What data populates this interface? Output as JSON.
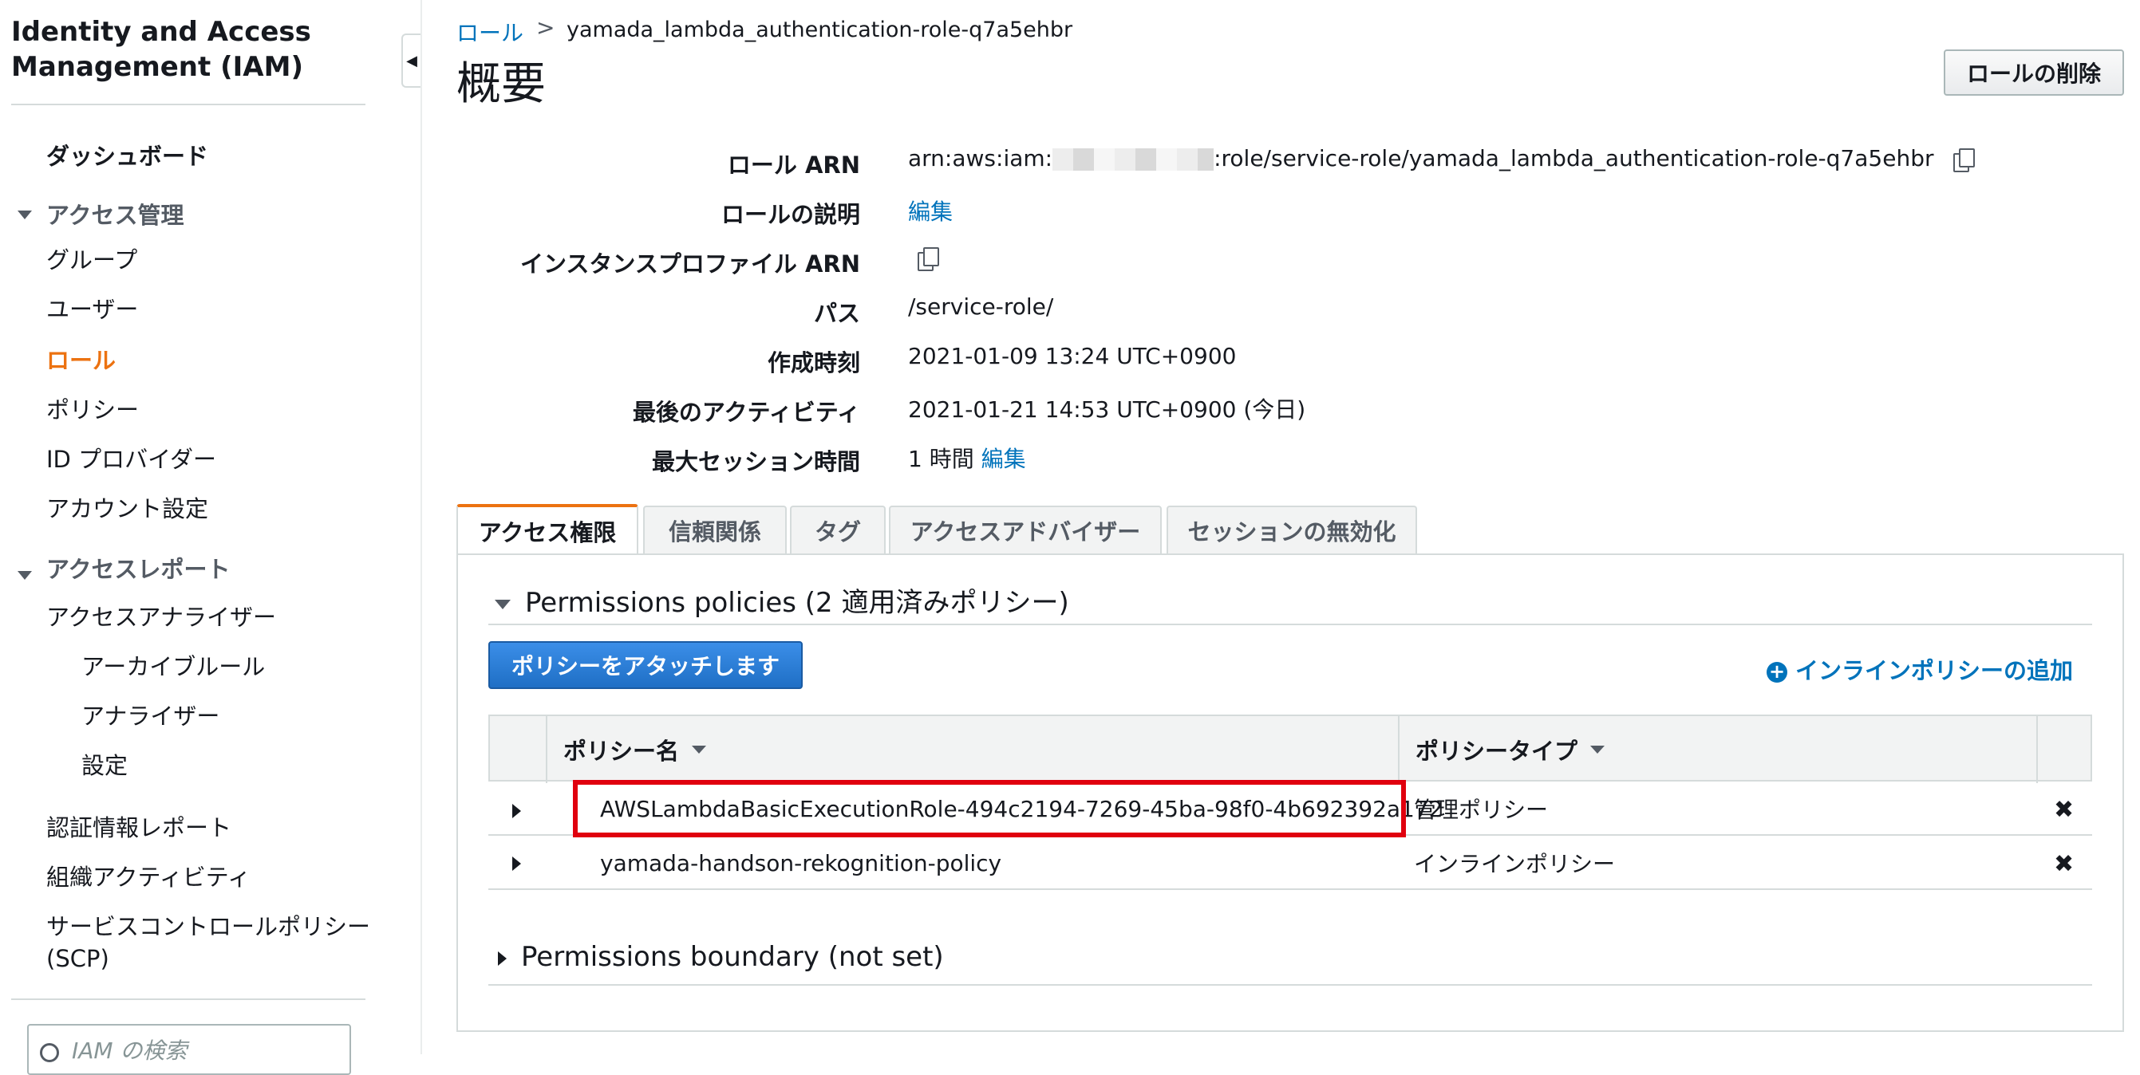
{
  "sidebar": {
    "title": "Identity and Access Management (IAM)",
    "dashboard": "ダッシュボード",
    "access_mgmt": {
      "label": "アクセス管理",
      "items": [
        "グループ",
        "ユーザー",
        "ロール",
        "ポリシー",
        "ID プロバイダー",
        "アカウント設定"
      ],
      "active_index": 2
    },
    "access_reports": {
      "label": "アクセスレポート",
      "analyzer": "アクセスアナライザー",
      "analyzer_children": [
        "アーカイブルール",
        "アナライザー",
        "設定"
      ],
      "credential_report": "認証情報レポート",
      "org_activity": "組織アクティビティ",
      "scp_line1": "サービスコントロールポリシー",
      "scp_line2": "(SCP)"
    },
    "search_placeholder": "IAM の検索"
  },
  "breadcrumb": {
    "parent": "ロール",
    "separator": ">",
    "current": "yamada_lambda_authentication-role-q7a5ehbr"
  },
  "page": {
    "title": "概要",
    "delete_button": "ロールの削除"
  },
  "summary": {
    "role_arn_label": "ロール ARN",
    "role_arn_prefix": "arn:aws:iam:",
    "role_arn_suffix": ":role/service-role/yamada_lambda_authentication-role-q7a5ehbr",
    "description_label": "ロールの説明",
    "description_edit": "編集",
    "instance_profile_label": "インスタンスプロファイル ARN",
    "path_label": "パス",
    "path_value": "/service-role/",
    "created_label": "作成時刻",
    "created_value": "2021-01-09 13:24 UTC+0900",
    "last_activity_label": "最後のアクティビティ",
    "last_activity_value": "2021-01-21 14:53 UTC+0900 (今日)",
    "max_session_label": "最大セッション時間",
    "max_session_value": "1 時間",
    "max_session_edit": "編集"
  },
  "tabs": [
    "アクセス権限",
    "信頼関係",
    "タグ",
    "アクセスアドバイザー",
    "セッションの無効化"
  ],
  "active_tab": 0,
  "permissions": {
    "section_title": "Permissions policies (2 適用済みポリシー)",
    "attach_button": "ポリシーをアタッチします",
    "inline_add": "インラインポリシーの追加",
    "columns": [
      "ポリシー名",
      "ポリシータイプ"
    ],
    "rows": [
      {
        "name": "AWSLambdaBasicExecutionRole-494c2194-7269-45ba-98f0-4b692392a172",
        "type": "管理ポリシー",
        "is_link": true
      },
      {
        "name": "yamada-handson-rekognition-policy",
        "type": "インラインポリシー",
        "is_link": false
      }
    ],
    "remove_icon": "✖",
    "boundary_title": "Permissions boundary (not set)"
  },
  "colors": {
    "link": "#0073bb",
    "active_orange": "#ec7211",
    "highlight_red": "#e0000e",
    "primary_button": "#1f6fc5"
  },
  "icons": {
    "copy": "copy-icon",
    "collapse": "chevron-left-icon",
    "add": "plus-circle-icon",
    "remove": "close-icon",
    "search": "search-icon"
  }
}
